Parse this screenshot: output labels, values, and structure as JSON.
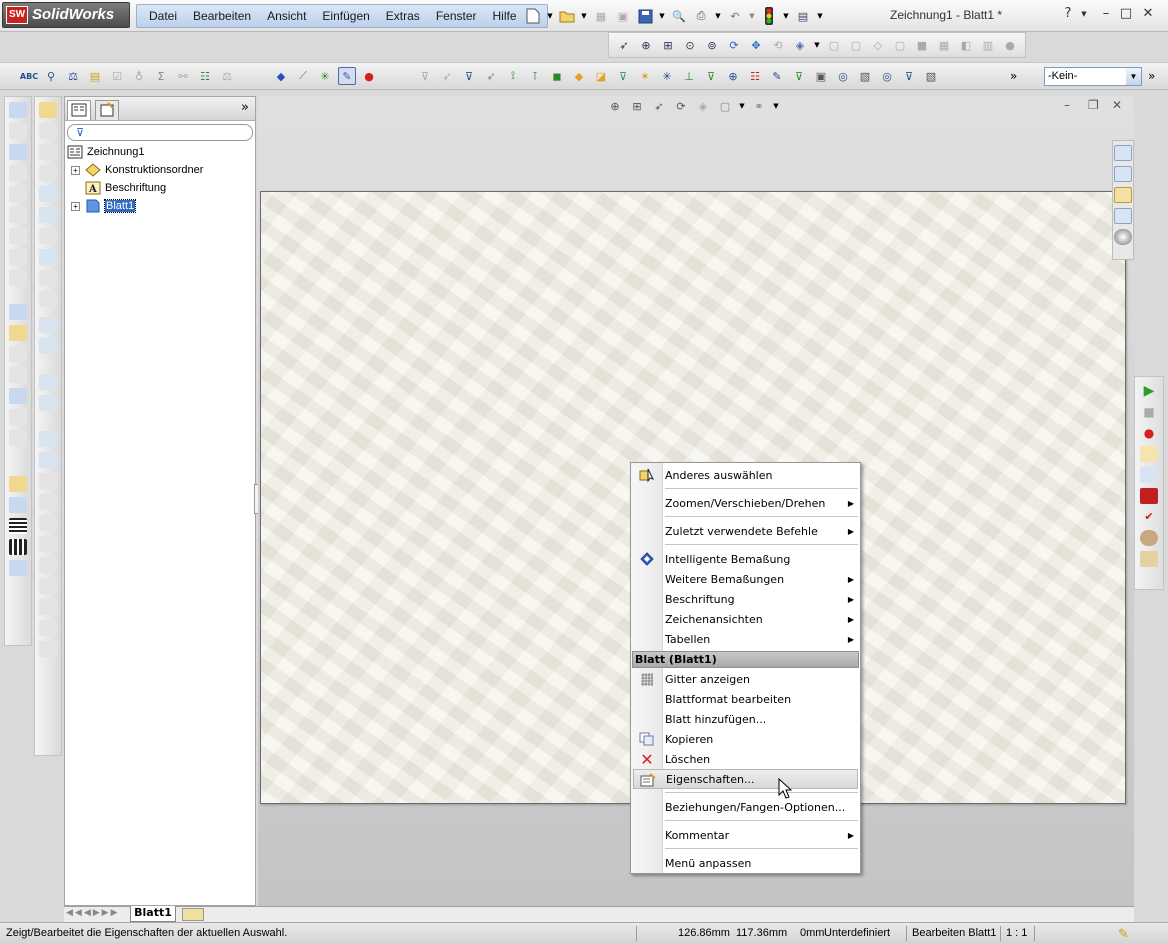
{
  "app": {
    "logo_badge": "SW",
    "logo_text": "SolidWorks",
    "document_title": "Zeichnung1 - Blatt1 *"
  },
  "menubar": {
    "items": [
      "Datei",
      "Bearbeiten",
      "Ansicht",
      "Einfügen",
      "Extras",
      "Fenster",
      "Hilfe"
    ]
  },
  "window_controls": {
    "help": "?",
    "minimize": "–",
    "restore": "□",
    "close": "✕"
  },
  "graphics_controls": {
    "minimize": "–",
    "restore": "❐",
    "close": "✕"
  },
  "layer_combo": {
    "value": "-Kein-"
  },
  "feature_tree": {
    "root": "Zeichnung1",
    "items": [
      {
        "label": "Konstruktionsordner",
        "expandable": true
      },
      {
        "label": "Beschriftung",
        "expandable": false
      },
      {
        "label": "Blatt1",
        "expandable": true,
        "selected": true
      }
    ]
  },
  "context_menu": {
    "items": [
      {
        "label": "Anderes auswählen",
        "submenu": false,
        "icon": "select-other-icon"
      },
      {
        "label": "Zoomen/Verschieben/Drehen",
        "submenu": true
      },
      {
        "label": "Zuletzt verwendete Befehle",
        "submenu": true
      },
      {
        "label": "Intelligente Bemaßung",
        "submenu": false,
        "icon": "smart-dimension-icon"
      },
      {
        "label": "Weitere Bemaßungen",
        "submenu": true
      },
      {
        "label": "Beschriftung",
        "submenu": true
      },
      {
        "label": "Zeichenansichten",
        "submenu": true
      },
      {
        "label": "Tabellen",
        "submenu": true
      },
      {
        "label": "Gitter anzeigen",
        "submenu": false,
        "icon": "grid-icon"
      },
      {
        "label": "Blattformat bearbeiten",
        "submenu": false
      },
      {
        "label": "Blatt hinzufügen...",
        "submenu": false
      },
      {
        "label": "Kopieren",
        "submenu": false,
        "icon": "copy-icon"
      },
      {
        "label": "Löschen",
        "submenu": false,
        "icon": "delete-icon"
      },
      {
        "label": "Eigenschaften...",
        "submenu": false,
        "icon": "properties-icon",
        "highlighted": true
      },
      {
        "label": "Beziehungen/Fangen-Optionen...",
        "submenu": false
      },
      {
        "label": "Kommentar",
        "submenu": true
      },
      {
        "label": "Menü anpassen",
        "submenu": false
      }
    ],
    "section_header": "Blatt (Blatt1)"
  },
  "sheet_tabs": {
    "active": "Blatt1"
  },
  "statusbar": {
    "message": "Zeigt/Bearbeitet die Eigenschaften der aktuellen Auswahl.",
    "x": "126.86mm",
    "y": "117.36mm",
    "z": "0mm",
    "state": "Unterdefiniert",
    "mode": "Bearbeiten Blatt1",
    "scale": "1 : 1"
  },
  "colors": {
    "accent": "#c9221c",
    "selection": "#316ac5",
    "menubar": "#c9d9ef"
  }
}
